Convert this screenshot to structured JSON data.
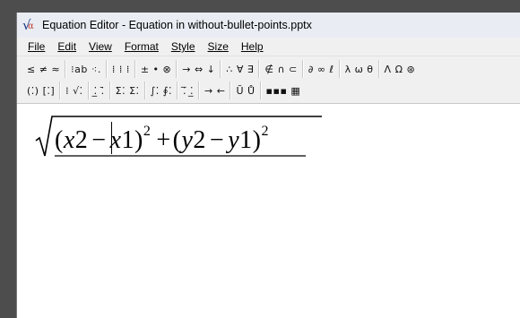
{
  "window": {
    "title": "Equation Editor - Equation in without-bullet-points.pptx"
  },
  "menu": {
    "items": [
      "File",
      "Edit",
      "View",
      "Format",
      "Style",
      "Size",
      "Help"
    ]
  },
  "toolbar": {
    "row1": [
      "≤ ≠ ≈",
      "⁝ab ⁖.",
      "⁞ ⁞ ⁞",
      "± • ⊗",
      "→ ⇔ ↓",
      "∴ ∀ ∃",
      "∉ ∩ ⊂",
      "∂ ∞ ℓ",
      "λ ω θ",
      "Λ Ω ⊛"
    ],
    "row2": [
      "(⁚) [⁚]",
      "⁞ √⁚",
      "⁚̲ ⁚̄",
      "Σ⁚ Σ⁚",
      "∫⁚ ∮⁚",
      "⁚̅ ⁚̲",
      "→ ←",
      "Ũ Ů",
      "▪▪▪ ▦"
    ]
  },
  "equation": {
    "sqrt": "√",
    "open1": "(",
    "x2": "x",
    "two_a": "2",
    "minus1": "−",
    "x1": "x",
    "one_a": "1)",
    "sup1": "2",
    "plus": "+",
    "open2": "(",
    "y2": "y",
    "two_b": "2",
    "minus2": "−",
    "y1": "y",
    "one_b": "1)",
    "sup2": "2"
  }
}
